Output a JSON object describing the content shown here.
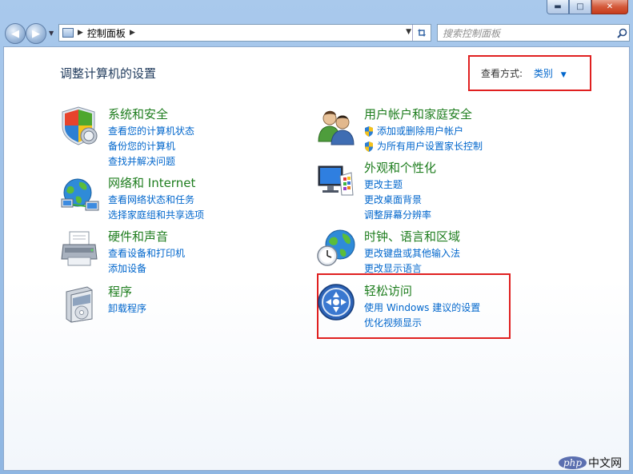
{
  "window": {
    "minimize": "▬",
    "maximize": "□",
    "close": "✕"
  },
  "address_bar": {
    "path_arrow": "▶",
    "path": "控制面板",
    "trail_arrow": "▶"
  },
  "search": {
    "placeholder": "搜索控制面板"
  },
  "main": {
    "title": "调整计算机的设置",
    "view_by_label": "查看方式:",
    "view_by_value": "类别"
  },
  "categories": [
    {
      "title": "系统和安全",
      "icon": "shield-icon",
      "links": [
        "查看您的计算机状态",
        "备份您的计算机",
        "查找并解决问题"
      ]
    },
    {
      "title": "网络和 Internet",
      "icon": "network-globe-icon",
      "links": [
        "查看网络状态和任务",
        "选择家庭组和共享选项"
      ]
    },
    {
      "title": "硬件和声音",
      "icon": "printer-icon",
      "links": [
        "查看设备和打印机",
        "添加设备"
      ]
    },
    {
      "title": "程序",
      "icon": "programs-box-icon",
      "links": [
        "卸载程序"
      ]
    },
    {
      "title": "用户帐户和家庭安全",
      "icon": "users-icon",
      "links": [
        "添加或删除用户帐户",
        "为所有用户设置家长控制"
      ]
    },
    {
      "title": "外观和个性化",
      "icon": "display-palette-icon",
      "links": [
        "更改主题",
        "更改桌面背景",
        "调整屏幕分辨率"
      ]
    },
    {
      "title": "时钟、语言和区域",
      "icon": "clock-globe-icon",
      "links": [
        "更改键盘或其他输入法",
        "更改显示语言"
      ]
    },
    {
      "title": "轻松访问",
      "icon": "ease-of-access-icon",
      "links": [
        "使用 Windows 建议的设置",
        "优化视频显示"
      ]
    }
  ],
  "watermark": {
    "brand": "php",
    "text": "中文网"
  }
}
